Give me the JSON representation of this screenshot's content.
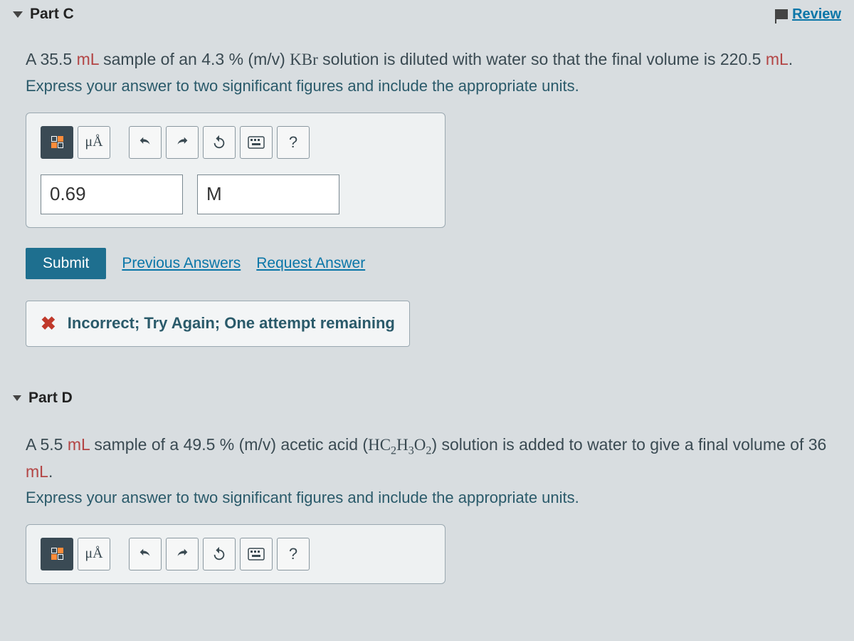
{
  "review_label": "Review",
  "partC": {
    "header": "Part C",
    "question_pre": "A 35.5 ",
    "question_unit1": "mL",
    "question_mid1": " sample of an 4.3 % (m/v) ",
    "question_chem": "KBr",
    "question_mid2": " solution is diluted with water so that the final volume is 220.5 ",
    "question_unit2": "mL",
    "question_post": ".",
    "instruction": "Express your answer to two significant figures and include the appropriate units.",
    "symbols_label": "μÅ",
    "help_label": "?",
    "value_entered": "0.69",
    "unit_entered": "M",
    "submit_label": "Submit",
    "prev_answers_label": "Previous Answers",
    "request_answer_label": "Request Answer",
    "feedback_text": "Incorrect; Try Again; One attempt remaining"
  },
  "partD": {
    "header": "Part D",
    "question_pre": "A 5.5 ",
    "question_unit1": "mL",
    "question_mid1": " sample of a 49.5 % (m/v) acetic acid (",
    "question_chem_html": "HC₂H₃O₂",
    "question_mid2": ") solution is added to water to give a final volume of 36 ",
    "question_unit2": "mL",
    "question_post": ".",
    "instruction": "Express your answer to two significant figures and include the appropriate units.",
    "symbols_label": "μÅ",
    "help_label": "?"
  }
}
